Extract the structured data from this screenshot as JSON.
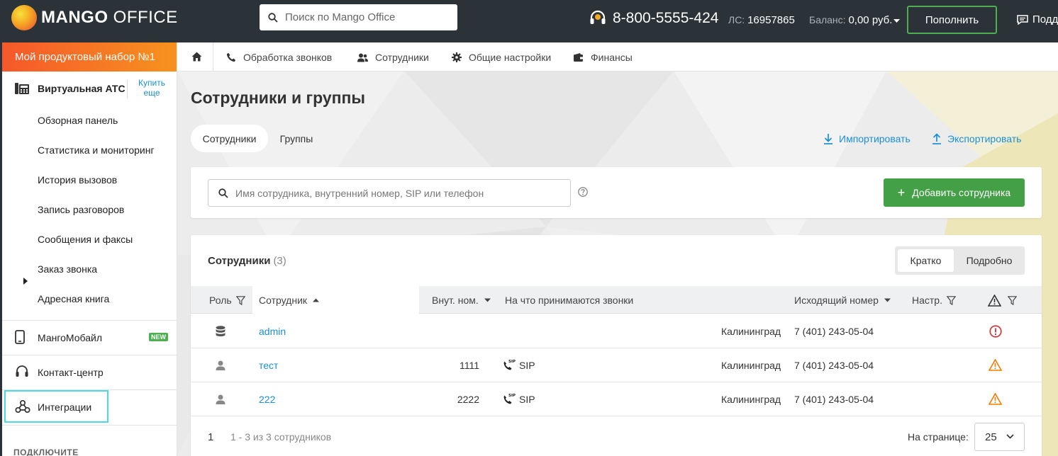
{
  "header": {
    "logo_bold": "MANGO",
    "logo_light": " OFFICE",
    "search_placeholder": "Поиск по Mango Office",
    "phone": "8-800-5555-424",
    "account_label": "ЛС:",
    "account_value": "16957865",
    "balance_label": "Баланс:",
    "balance_value": "0,00 руб.",
    "topup_label": "Пополнить",
    "support_label": "Подд"
  },
  "sidebar": {
    "product_banner": "Мой продуктовый набор №1",
    "pbx_title": "Виртуальная АТС",
    "buy_more": "Купить еще",
    "items": [
      {
        "label": "Обзорная панель"
      },
      {
        "label": "Статистика и мониторинг"
      },
      {
        "label": "История вызовов"
      },
      {
        "label": "Запись разговоров"
      },
      {
        "label": "Сообщения и факсы"
      },
      {
        "label": "Заказ звонка"
      },
      {
        "label": "Адресная книга"
      }
    ],
    "sections": [
      {
        "label": "МангоМобайл",
        "badge": "NEW"
      },
      {
        "label": "Контакт-центр"
      },
      {
        "label": "Интеграции"
      }
    ],
    "connect_label": "ПОДКЛЮЧИТЕ"
  },
  "nav": {
    "items": [
      {
        "label": "Обработка звонков"
      },
      {
        "label": "Сотрудники"
      },
      {
        "label": "Общие настройки"
      },
      {
        "label": "Финансы"
      }
    ]
  },
  "page": {
    "title": "Сотрудники и группы",
    "tabs": [
      {
        "label": "Сотрудники"
      },
      {
        "label": "Группы"
      }
    ],
    "import_label": "Импортировать",
    "export_label": "Экспортировать",
    "search_placeholder": "Имя сотрудника, внутренний номер, SIP или телефон",
    "add_label": "Добавить сотрудника"
  },
  "table": {
    "title": "Сотрудники",
    "count": "(3)",
    "view_short": "Кратко",
    "view_detailed": "Подробно",
    "columns": {
      "role": "Роль",
      "employee": "Сотрудник",
      "ext": "Внут. ном.",
      "receive": "На что принимаются звонки",
      "outgoing": "Исходящий номер",
      "settings": "Настр."
    },
    "rows": [
      {
        "role_icon": "database-icon",
        "name": "admin",
        "ext": "",
        "receive": "",
        "city": "Калининград",
        "number": "7 (401) 243-05-04",
        "status": "error"
      },
      {
        "role_icon": "user-icon",
        "name": "тест",
        "ext": "1111",
        "receive": "SIP",
        "city": "Калининград",
        "number": "7 (401) 243-05-04",
        "status": "warning"
      },
      {
        "role_icon": "user-icon",
        "name": "222",
        "ext": "2222",
        "receive": "SIP",
        "city": "Калининград",
        "number": "7 (401) 243-05-04",
        "status": "warning"
      }
    ],
    "pager": {
      "page": "1",
      "range": "1 - 3 из 3 сотрудников",
      "per_page_label": "На странице:",
      "per_page_value": "25"
    }
  },
  "colors": {
    "topbar": "#2b3339",
    "accent_blue": "#1a8fd8",
    "accent_green": "#43a047",
    "banner_orange": "#f5582a",
    "error_red": "#d32f2f",
    "warning_orange": "#f57c00"
  }
}
